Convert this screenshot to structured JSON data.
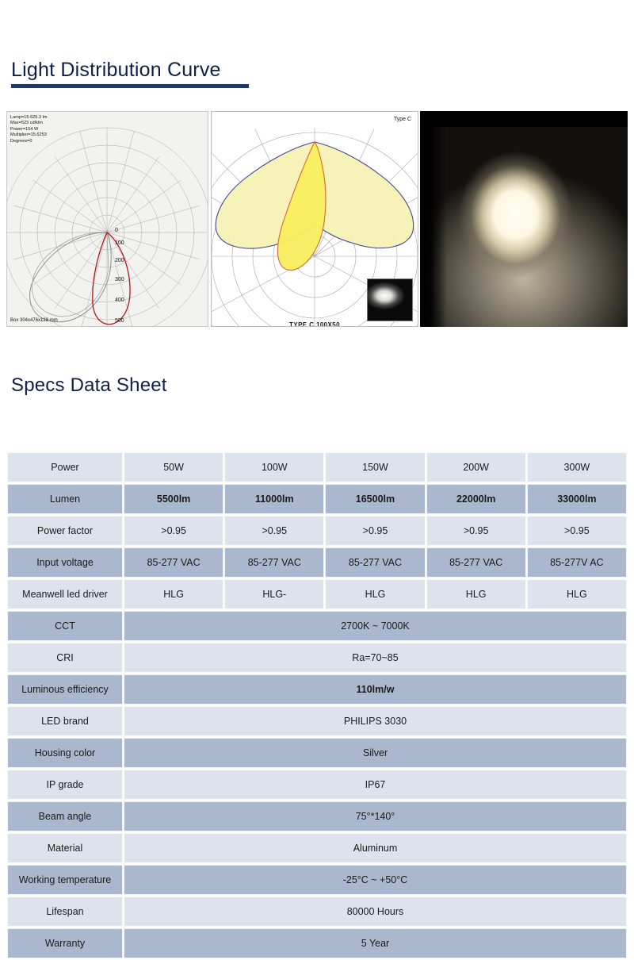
{
  "sections": {
    "light_curve_title": "Light Distribution Curve",
    "specs_title": "Specs Data Sheet"
  },
  "polar_diagram": {
    "meta": "Lamp=15 625.3 lm\nMax=523 cd/klm\nPower=154 W\nMultiplier=15.6253\nDegrees=0",
    "box_note": "Box 304x476x128 mm",
    "scale_labels": [
      "0",
      "100",
      "200",
      "300",
      "400",
      "500"
    ]
  },
  "iso_diagram": {
    "type_label": "Type C",
    "caption": "TYPE  C  100X50",
    "curve_outer_color": "#f5f0a8",
    "curve_inner_color": "#f7ec62",
    "outline_color": "#3b3b8f",
    "inner_outline_color": "#d4622a"
  },
  "colors": {
    "heading": "#0f1f46",
    "rule": "#1f3864",
    "row_light": "#dde3ec",
    "row_dark": "#a9b8ce"
  },
  "spec_table": {
    "rows": [
      {
        "label": "Power",
        "band": "light",
        "cells": [
          "50W",
          "100W",
          "150W",
          "200W",
          "300W"
        ]
      },
      {
        "label": "Lumen",
        "band": "dark",
        "bold": true,
        "cells": [
          "5500lm",
          "11000lm",
          "16500lm",
          "22000lm",
          "33000lm"
        ]
      },
      {
        "label": "Power factor",
        "band": "light",
        "cells": [
          ">0.95",
          ">0.95",
          ">0.95",
          ">0.95",
          ">0.95"
        ]
      },
      {
        "label": "Input voltage",
        "band": "dark",
        "cells": [
          "85-277 VAC",
          "85-277 VAC",
          "85-277 VAC",
          "85-277 VAC",
          "85-277V AC"
        ]
      },
      {
        "label": "Meanwell led driver",
        "band": "light",
        "tall": true,
        "cells": [
          "HLG",
          "HLG-",
          "HLG",
          "HLG",
          "HLG"
        ]
      },
      {
        "label": "CCT",
        "band": "dark",
        "merged": "2700K ~ 7000K"
      },
      {
        "label": "CRI",
        "band": "light",
        "merged": "Ra=70~85"
      },
      {
        "label": "Luminous efficiency",
        "band": "dark",
        "tall": true,
        "bold": true,
        "merged": "110lm/w"
      },
      {
        "label": "LED  brand",
        "band": "light",
        "merged": "PHILIPS 3030"
      },
      {
        "label": "Housing color",
        "band": "dark",
        "merged": "Silver"
      },
      {
        "label": "IP grade",
        "band": "light",
        "merged": "IP67"
      },
      {
        "label": "Beam angle",
        "band": "dark",
        "merged": "75°*140°"
      },
      {
        "label": "Material",
        "band": "light",
        "merged": "Aluminum"
      },
      {
        "label": "Working temperature",
        "band": "dark",
        "tall": true,
        "merged": "-25°C ~ +50°C"
      },
      {
        "label": "Lifespan",
        "band": "light",
        "merged": "80000 Hours"
      },
      {
        "label": "Warranty",
        "band": "dark",
        "merged": "5 Year"
      }
    ]
  }
}
